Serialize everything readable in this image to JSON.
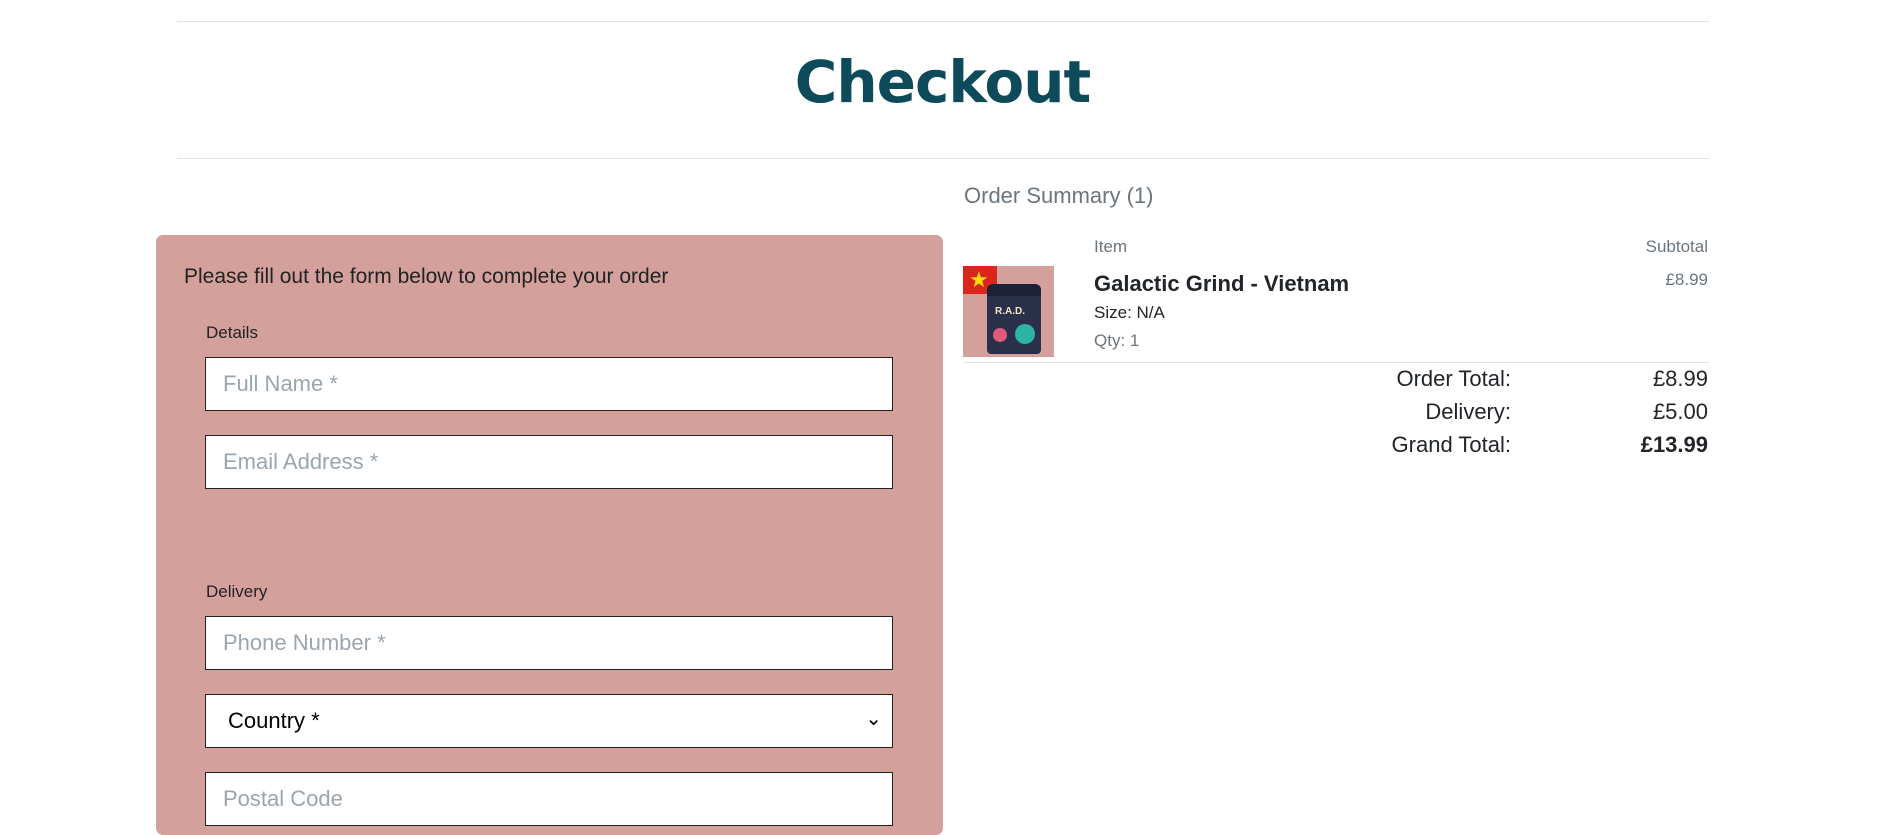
{
  "page": {
    "title": "Checkout"
  },
  "form": {
    "intro": "Please fill out the form below to complete your order",
    "details_legend": "Details",
    "full_name_placeholder": "Full Name *",
    "email_placeholder": "Email Address *",
    "delivery_legend": "Delivery",
    "phone_placeholder": "Phone Number *",
    "country_selected": "Country *",
    "postal_placeholder": "Postal Code"
  },
  "summary": {
    "title": "Order Summary (1)",
    "col_item": "Item",
    "col_subtotal": "Subtotal",
    "items": [
      {
        "name": "Galactic Grind - Vietnam",
        "size": "Size: N/A",
        "qty": "Qty: 1",
        "subtotal": "£8.99",
        "bag_label": "R.A.D."
      }
    ],
    "order_total_label": "Order Total:",
    "order_total_value": "£8.99",
    "delivery_label": "Delivery:",
    "delivery_value": "£5.00",
    "grand_total_label": "Grand Total:",
    "grand_total_value": "£13.99"
  },
  "colors": {
    "title": "#0d4a5a",
    "form_background": "#d4a09c",
    "muted_text": "#6c757d"
  },
  "icons": {
    "select_arrow": "chevron-down-icon",
    "flag": "vietnam-flag-icon"
  }
}
